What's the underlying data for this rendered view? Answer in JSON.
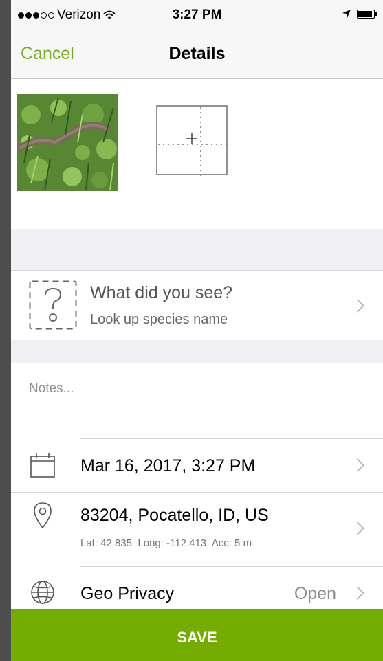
{
  "status_bar": {
    "carrier": "Verizon",
    "time": "3:27 PM"
  },
  "nav": {
    "cancel_label": "Cancel",
    "title": "Details"
  },
  "photos": {
    "thumbnail_icon": "photo-thumbnail",
    "add_photo_icon": "add-photo-icon"
  },
  "species": {
    "prompt": "What did you see?",
    "hint": "Look up species name",
    "icon": "unknown-species-icon"
  },
  "notes": {
    "placeholder": "Notes..."
  },
  "date": {
    "value": "Mar 16, 2017, 3:27 PM",
    "icon": "calendar-icon"
  },
  "location": {
    "place": "83204, Pocatello, ID, US",
    "coords": "Lat: 42.835  Long: -112.413  Acc: 5 m",
    "icon": "location-pin-icon"
  },
  "geo_privacy": {
    "label": "Geo Privacy",
    "value": "Open",
    "icon": "globe-icon"
  },
  "save_label": "SAVE",
  "colors": {
    "accent": "#74ac1f",
    "save_bar": "#74ac00"
  }
}
